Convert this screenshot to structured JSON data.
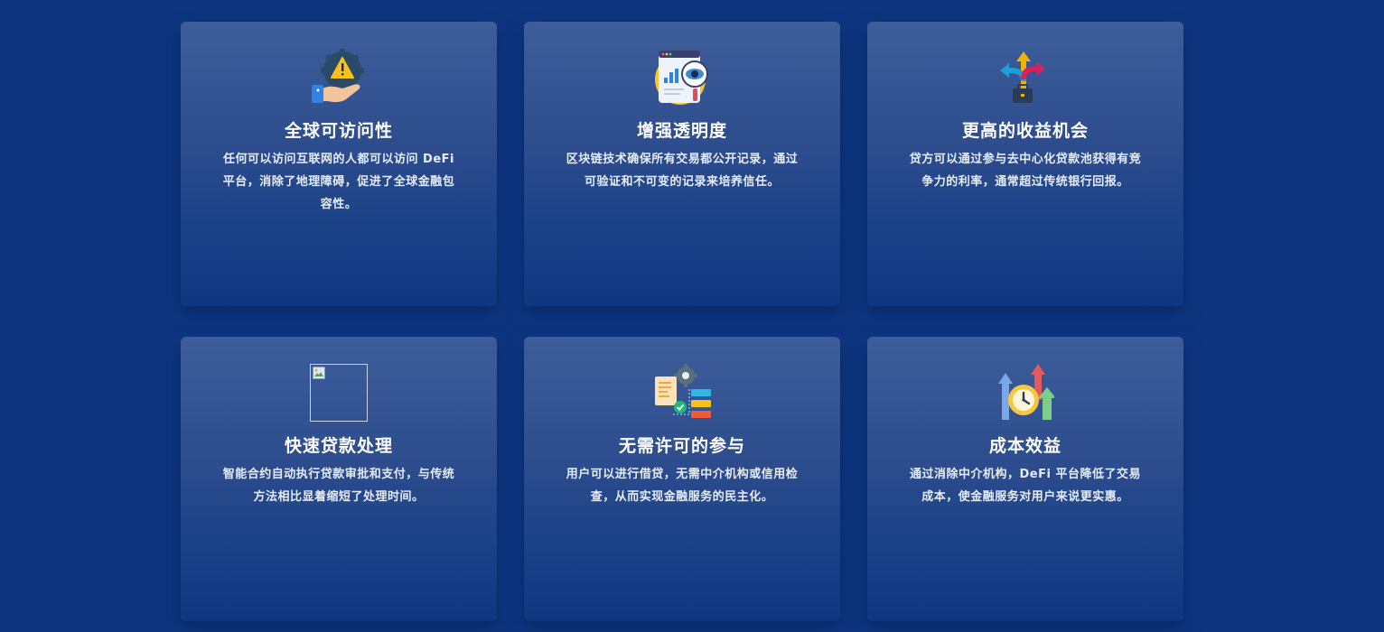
{
  "features": [
    {
      "icon": "globe-hand-warning-icon",
      "title": "全球可访问性",
      "description": "任何可以访问互联网的人都可以访问 DeFi 平台，消除了地理障碍，促进了全球金融包容性。"
    },
    {
      "icon": "analytics-eye-icon",
      "title": "增强透明度",
      "description": "区块链技术确保所有交易都公开记录，通过可验证和不可变的记录来培养信任。"
    },
    {
      "icon": "arrows-briefcase-icon",
      "title": "更高的收益机会",
      "description": "贷方可以通过参与去中心化贷款池获得有竞争力的利率，通常超过传统银行回报。"
    },
    {
      "icon": "broken-image-icon",
      "title": "快速贷款处理",
      "description": "智能合约自动执行贷款审批和支付，与传统方法相比显着缩短了处理时间。"
    },
    {
      "icon": "document-workflow-icon",
      "title": "无需许可的参与",
      "description": "用户可以进行借贷，无需中介机构或信用检查，从而实现金融服务的民主化。"
    },
    {
      "icon": "clock-arrows-up-icon",
      "title": "成本效益",
      "description": "通过消除中介机构，DeFi 平台降低了交易成本，使金融服务对用户来说更实惠。"
    }
  ]
}
